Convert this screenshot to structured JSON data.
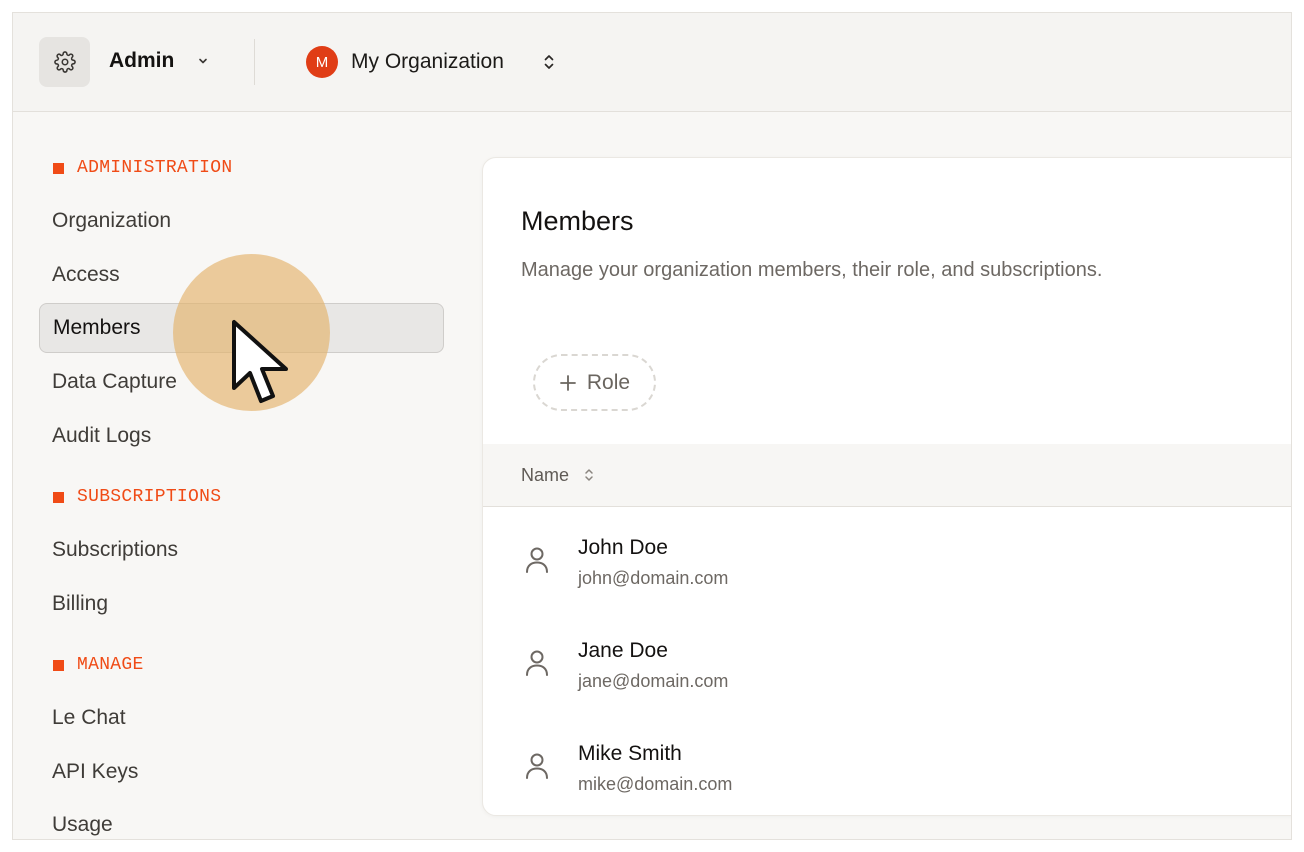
{
  "topbar": {
    "admin_label": "Admin",
    "org_avatar_letter": "M",
    "org_name": "My Organization"
  },
  "sidebar": {
    "sections": [
      {
        "title": "ADMINISTRATION",
        "items": [
          "Organization",
          "Access",
          "Members",
          "Data Capture",
          "Audit Logs"
        ]
      },
      {
        "title": "SUBSCRIPTIONS",
        "items": [
          "Subscriptions",
          "Billing"
        ]
      },
      {
        "title": "MANAGE",
        "items": [
          "Le Chat",
          "API Keys",
          "Usage"
        ]
      }
    ],
    "active_item": "Members"
  },
  "main": {
    "title": "Members",
    "description": "Manage your organization members, their role, and subscriptions.",
    "role_button_label": "Role",
    "table": {
      "column_name": "Name",
      "rows": [
        {
          "name": "John Doe",
          "email": "john@domain.com"
        },
        {
          "name": "Jane Doe",
          "email": "jane@domain.com"
        },
        {
          "name": "Mike Smith",
          "email": "mike@domain.com"
        }
      ]
    }
  },
  "colors": {
    "accent": "#f04b16",
    "avatar": "#e03d16",
    "cursor_halo": "#e4b26a"
  },
  "icons": {
    "admin": "gear-icon",
    "admin_dropdown": "chevron-down-icon",
    "org_switch": "chevron-up-down-icon",
    "role_add": "plus-icon",
    "sort": "sort-icon",
    "member": "person-icon",
    "cursor": "cursor-arrow-icon"
  }
}
